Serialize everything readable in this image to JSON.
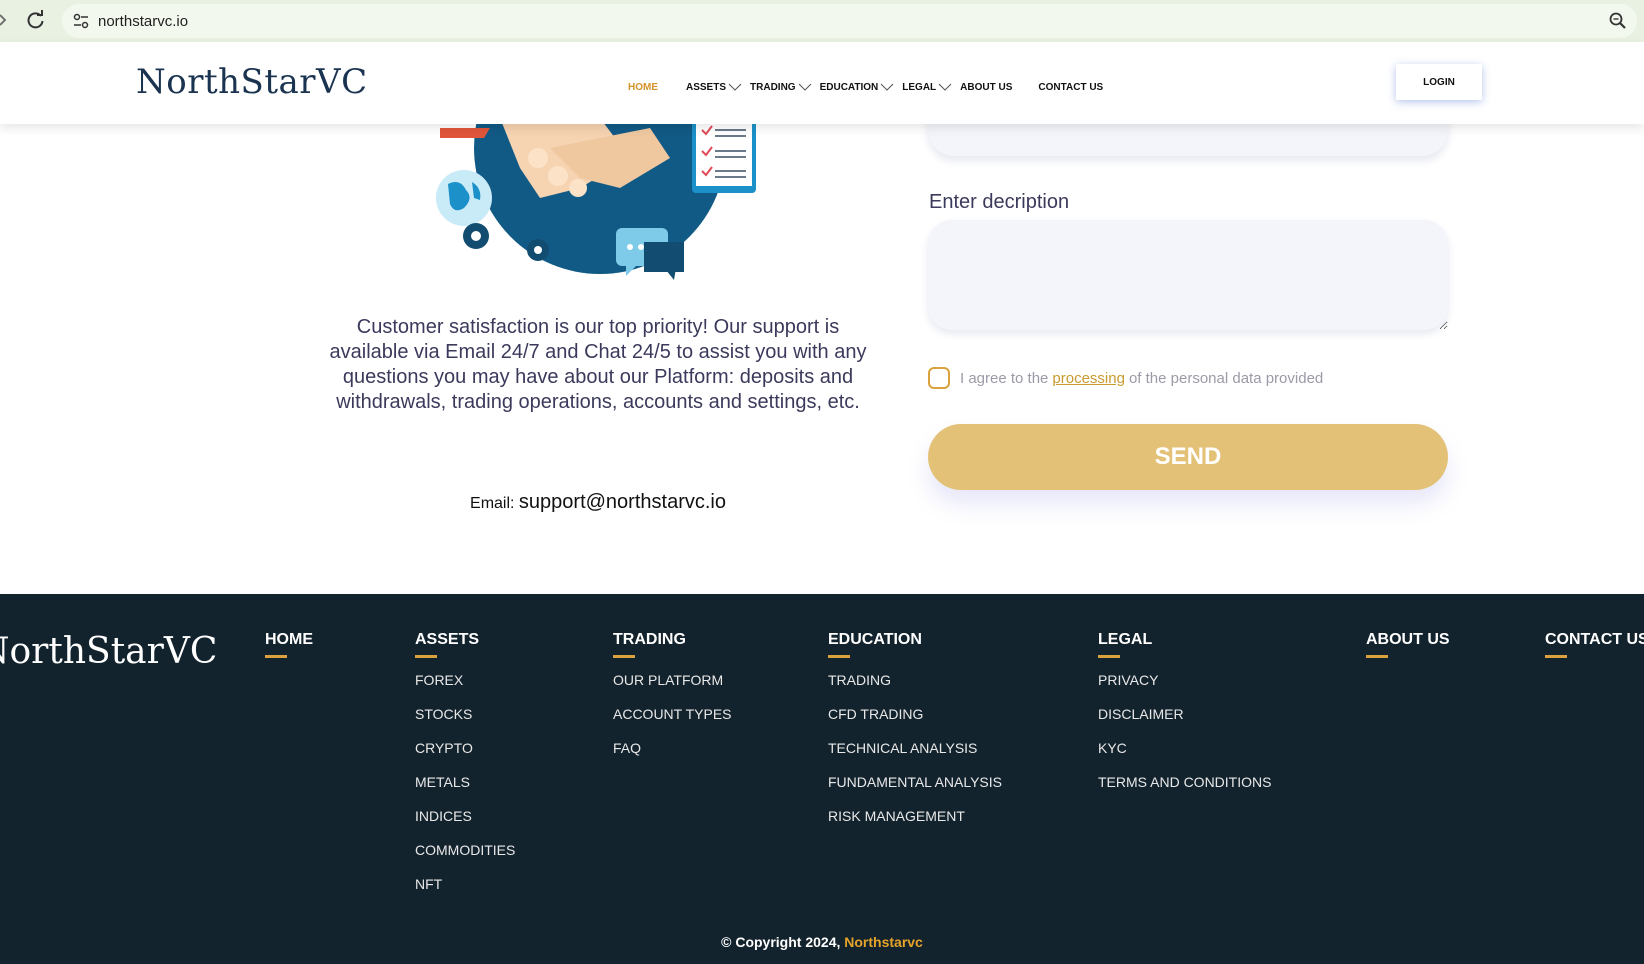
{
  "browser": {
    "url": "northstarvc.io",
    "icons": [
      "forward-icon",
      "reload-icon",
      "site-info-icon",
      "zoom-icon"
    ]
  },
  "header": {
    "logo_text": "NorthStarVC",
    "nav": {
      "home": "HOME",
      "assets": "ASSETS",
      "trading": "TRADING",
      "education": "EDUCATION",
      "legal": "LEGAL",
      "about": "ABOUT US",
      "contact": "CONTACT US"
    },
    "login_label": "LOGIN",
    "active_color": "#d4932a"
  },
  "main": {
    "support_text": "Customer satisfaction is our top priority! Our support is available via Email 24/7 and Chat 24/5 to assist you with any questions you may have about our Platform: deposits and withdrawals, trading operations, accounts and settings, etc.",
    "email_label": "Email:",
    "email_address": "support@northstarvc.io"
  },
  "form": {
    "description_label": "Enter decription",
    "description_value": "",
    "agree_prefix": "I agree to the",
    "agree_link": "processing",
    "agree_suffix": "of the personal data provided",
    "send_label": "SEND",
    "send_color": "#e3c277"
  },
  "footer": {
    "logo_text": "NorthStarVC",
    "columns": [
      {
        "title": "HOME",
        "links": []
      },
      {
        "title": "ASSETS",
        "links": [
          "FOREX",
          "STOCKS",
          "CRYPTO",
          "METALS",
          "INDICES",
          "COMMODITIES",
          "NFT"
        ]
      },
      {
        "title": "TRADING",
        "links": [
          "OUR PLATFORM",
          "ACCOUNT TYPES",
          "FAQ"
        ]
      },
      {
        "title": "EDUCATION",
        "links": [
          "TRADING",
          "CFD TRADING",
          "TECHNICAL ANALYSIS",
          "FUNDAMENTAL ANALYSIS",
          "RISK MANAGEMENT"
        ]
      },
      {
        "title": "LEGAL",
        "links": [
          "PRIVACY",
          "DISCLAIMER",
          "KYC",
          "TERMS AND CONDITIONS"
        ]
      },
      {
        "title": "ABOUT US",
        "links": []
      },
      {
        "title": "CONTACT US",
        "links": []
      }
    ],
    "copyright_prefix": "© Copyright 2024,",
    "copyright_brand": "Northstarvc",
    "background": "#13232d",
    "accent": "#d9a23c"
  }
}
